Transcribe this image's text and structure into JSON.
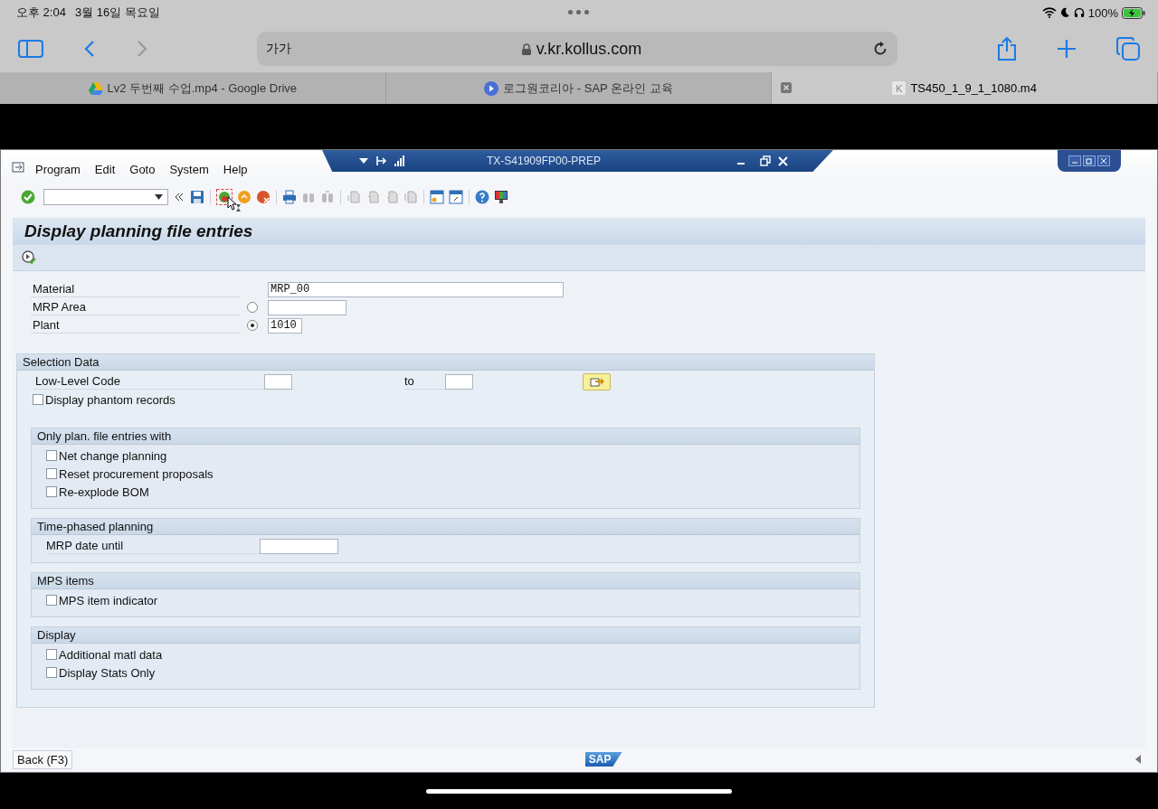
{
  "device_status": {
    "time": "오후 2:04",
    "date": "3월 16일 목요일",
    "battery": "100%"
  },
  "browser": {
    "text_size": "가가",
    "url": "v.kr.kollus.com"
  },
  "tabs": [
    {
      "label": "Lv2 두번째 수업.mp4 - Google Drive",
      "selected": false,
      "kind": "drive"
    },
    {
      "label": "로그원코리아 - SAP 온라인 교육",
      "selected": false,
      "kind": "play"
    },
    {
      "label": "TS450_1_9_1_1080.m4",
      "selected": true,
      "kind": "letter",
      "icon_letter": "K"
    }
  ],
  "sap": {
    "menu": [
      "Program",
      "Edit",
      "Goto",
      "System",
      "Help"
    ],
    "system_title": "TX-S41909FP00-PREP",
    "page_title": "Display planning file entries",
    "header_fields": [
      {
        "label": "Material",
        "kind": "field",
        "value": "MRP_00"
      },
      {
        "label": "MRP Area",
        "kind": "radio",
        "selected": false
      },
      {
        "label": "Plant",
        "kind": "radio",
        "selected": true,
        "value": "1010"
      }
    ],
    "selection_data": {
      "title": "Selection Data",
      "low_level_code": "Low-Level Code",
      "to": "to",
      "phantom": {
        "label": "Display phantom records",
        "checked": false
      },
      "groups": [
        {
          "title": "Only plan. file entries with",
          "rows": [
            {
              "kind": "checkbox",
              "label": "Net change planning",
              "checked": false
            },
            {
              "kind": "checkbox",
              "label": "Reset procurement proposals",
              "checked": false
            },
            {
              "kind": "checkbox",
              "label": "Re-explode BOM",
              "checked": false
            }
          ]
        },
        {
          "title": "Time-phased planning",
          "rows": [
            {
              "kind": "field",
              "label": "MRP date until"
            }
          ]
        },
        {
          "title": "MPS items",
          "rows": [
            {
              "kind": "checkbox",
              "label": "MPS item indicator",
              "checked": false
            }
          ]
        },
        {
          "title": "Display",
          "rows": [
            {
              "kind": "checkbox",
              "label": "Additional matl data",
              "checked": false
            },
            {
              "kind": "checkbox",
              "label": "Display Stats Only",
              "checked": false
            }
          ]
        }
      ]
    },
    "status": {
      "back": "Back  (F3)",
      "logo": "SAP"
    }
  }
}
